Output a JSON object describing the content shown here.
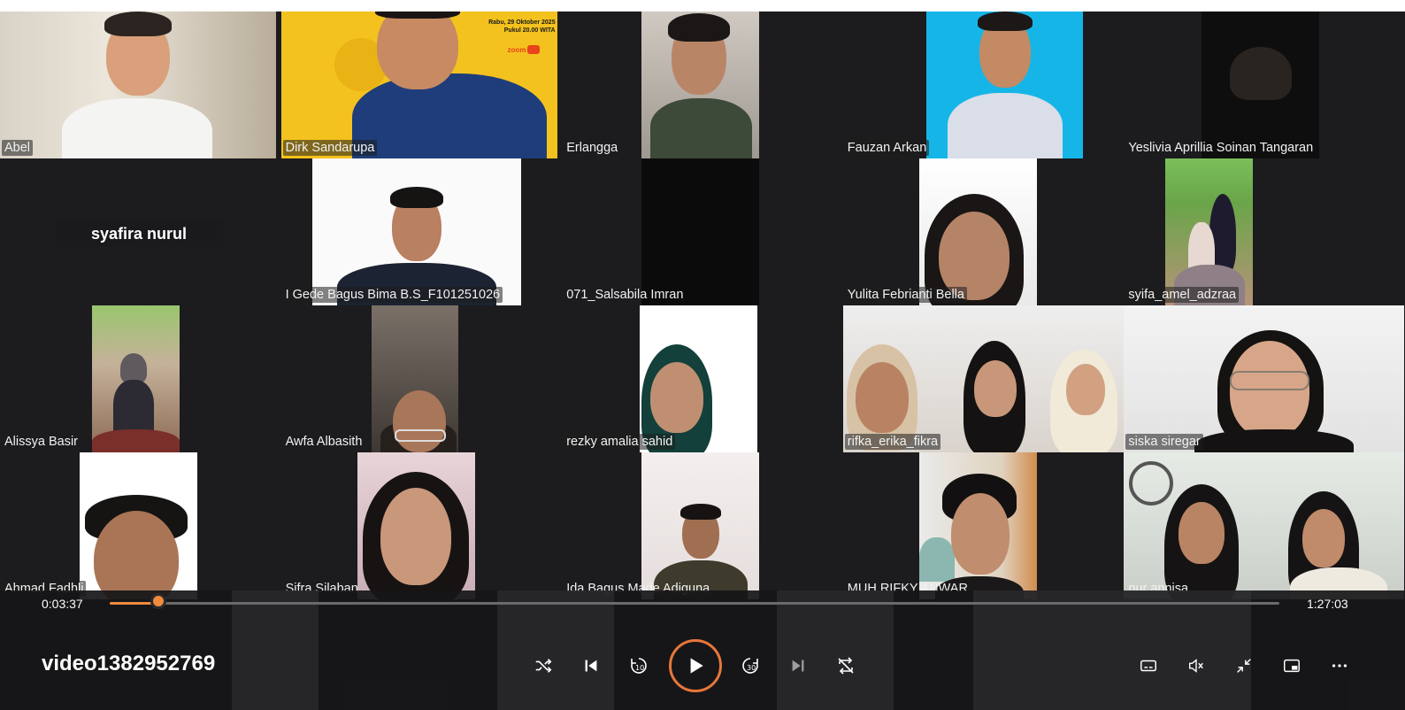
{
  "participants": [
    "Abel",
    "Dirk Sandarupa",
    "Erlangga",
    "Fauzan Arkan",
    "Yeslivia Aprillia Soinan Tangaran",
    "syafira nurul",
    "I Gede Bagus Bima B.S_F101251026",
    "071_Salsabila Imran",
    "Yulita Febrianti Bella",
    "syifa_amel_adzraa",
    "Alissya Basir",
    "Awfa Albasith",
    "rezky amalia sahid",
    "rifka_erika_fikra",
    "siska siregar",
    "Ahmad Fadhli",
    "Sifra Silaban",
    "Ida Bagus Made Adiguna",
    "MUH.RIFKY ANWAR",
    "nur annisa"
  ],
  "poster": {
    "line1": "Rabu, 29 Oktober 2025",
    "line2": "Pukul 20.00 WITA",
    "logo": "zoom"
  },
  "player": {
    "title": "video1382952769",
    "elapsed": "0:03:37",
    "duration": "1:27:03",
    "progress": 0.0416,
    "accent_color": "#f08a3c"
  },
  "icons": {
    "shuffle": "shuffle-icon",
    "previous": "previous-icon",
    "rewind": "rewind-10-icon",
    "play": "play-icon",
    "forward": "forward-30-icon",
    "next": "next-icon",
    "repeat": "repeat-off-icon",
    "captions": "captions-icon",
    "mute": "mute-icon",
    "minimize": "minimize-icon",
    "miniplayer": "miniplayer-icon",
    "more": "more-icon"
  }
}
